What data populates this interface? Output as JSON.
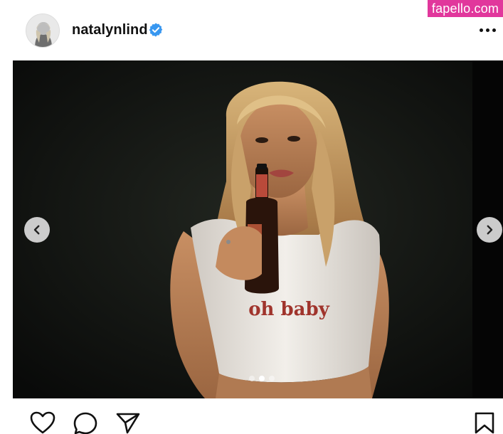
{
  "header": {
    "username": "natalynlind",
    "verified": true,
    "watermark": "fapello.com"
  },
  "media": {
    "alt": "Photo post",
    "shirt_text": "oh baby",
    "carousel": {
      "count": 3,
      "active_index": 1
    }
  },
  "colors": {
    "verified_blue": "#3897f0",
    "watermark_pink": "#e1379c",
    "text": "#111111"
  },
  "icons": {
    "prev": "chevron-left-icon",
    "next": "chevron-right-icon",
    "like": "heart-icon",
    "comment": "comment-icon",
    "share": "paper-plane-icon",
    "save": "bookmark-icon",
    "more": "more-dots-icon"
  }
}
